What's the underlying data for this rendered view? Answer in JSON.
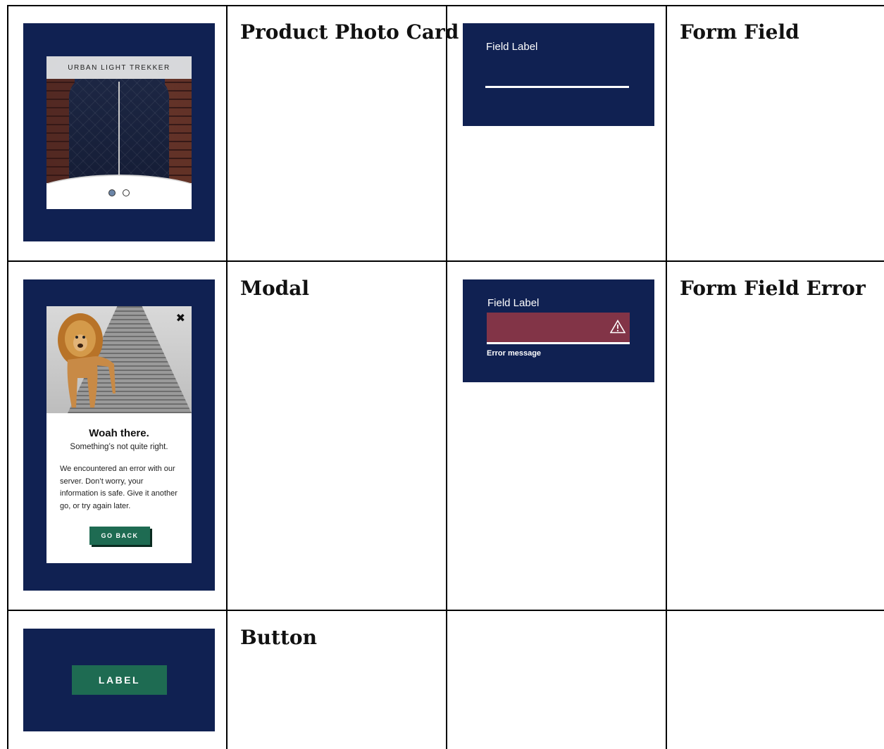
{
  "components": [
    {
      "title": "Product Photo Card",
      "card": {
        "product_name": "URBAN LIGHT TREKKER",
        "carousel_dots": [
          {
            "active": true
          },
          {
            "active": false
          }
        ]
      }
    },
    {
      "title": "Form Field",
      "field": {
        "label": "Field Label"
      }
    },
    {
      "title": "Modal",
      "modal": {
        "close_icon": "close-icon",
        "heading": "Woah there.",
        "subheading": "Something’s not quite right.",
        "body": "We encountered an error with our server. Don’t worry, your information is safe. Give it another go, or try again later.",
        "button_label": "GO BACK"
      }
    },
    {
      "title": "Form Field Error",
      "field": {
        "label": "Field Label",
        "error_message": "Error message",
        "icon": "warning-icon"
      }
    },
    {
      "title": "Button",
      "button": {
        "label": "LABEL"
      }
    }
  ],
  "colors": {
    "navy": "#102152",
    "green": "#1e6b52",
    "error_fill": "#823447"
  }
}
